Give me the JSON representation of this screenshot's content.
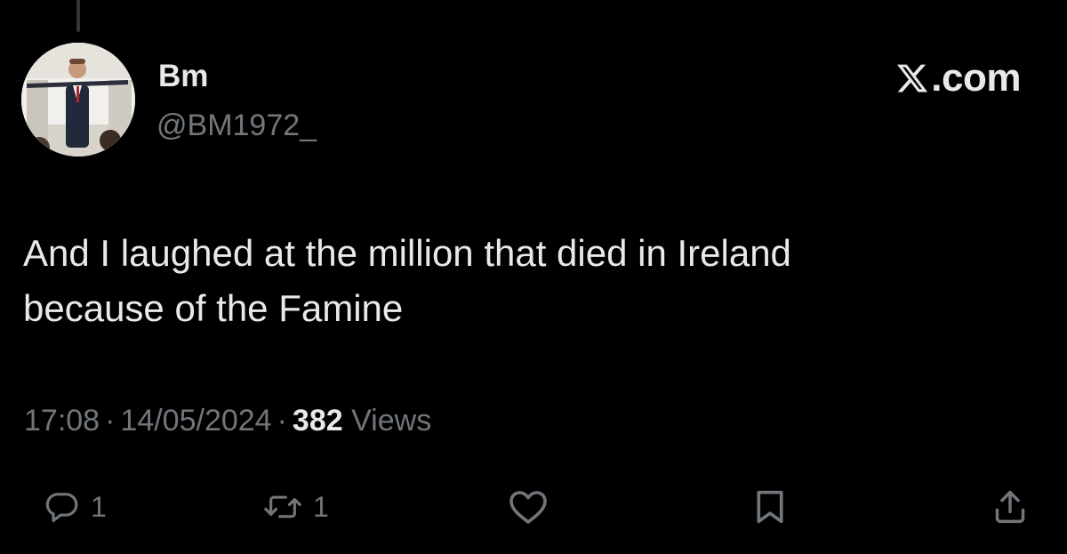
{
  "author": {
    "display_name": "Bm",
    "handle": "@BM1972_"
  },
  "brand": {
    "label": ".com",
    "icon": "x-logo-icon"
  },
  "tweet": {
    "text": "And I laughed at the million that died in Ireland\nbecause of the Famine"
  },
  "meta": {
    "time": "17:08",
    "separator": "·",
    "date": "14/05/2024",
    "views_count": "382",
    "views_label": "Views"
  },
  "actions": {
    "reply": {
      "icon": "reply-icon",
      "count": "1"
    },
    "repost": {
      "icon": "repost-icon",
      "count": "1"
    },
    "like": {
      "icon": "heart-icon"
    },
    "bookmark": {
      "icon": "bookmark-icon"
    },
    "share": {
      "icon": "share-icon"
    }
  },
  "colors": {
    "background": "#000000",
    "primary_text": "#e7e9ea",
    "secondary_text": "#71767b"
  }
}
